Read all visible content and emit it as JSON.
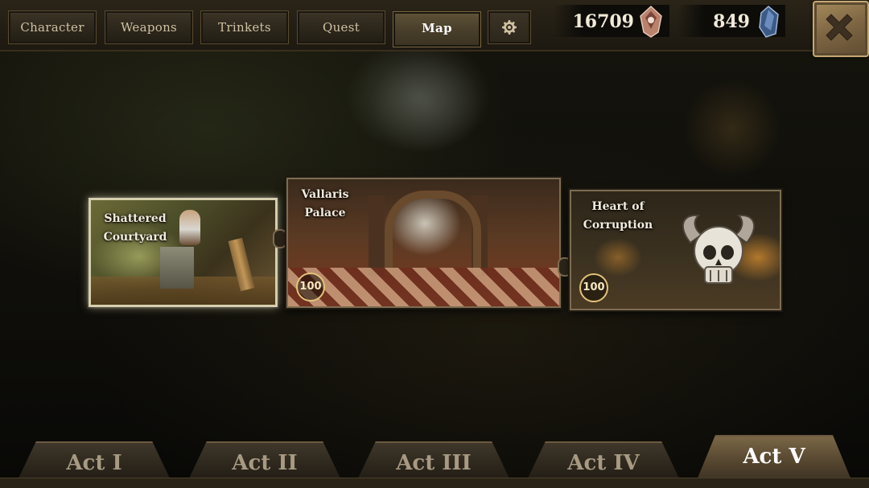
{
  "top_tabs": [
    {
      "label": "Character"
    },
    {
      "label": "Weapons"
    },
    {
      "label": "Trinkets"
    },
    {
      "label": "Quest"
    },
    {
      "label": "Map"
    }
  ],
  "active_top_tab": "Map",
  "icons": {
    "settings": "gear-icon",
    "gold": "gold-gem-icon",
    "gems": "blue-crystal-icon",
    "close": "close-x-icon"
  },
  "currency": {
    "gold": "16709",
    "gems": "849"
  },
  "levels": [
    {
      "name": "Shattered Courtyard",
      "line1": "Shattered",
      "line2": "Courtyard",
      "badge": ""
    },
    {
      "name": "Vallaris Palace",
      "line1": "Vallaris",
      "line2": "Palace",
      "badge": "100"
    },
    {
      "name": "Heart of Corruption",
      "line1": "Heart of",
      "line2": "Corruption",
      "badge": "100"
    }
  ],
  "acts": [
    {
      "label": "Act I"
    },
    {
      "label": "Act II"
    },
    {
      "label": "Act III"
    },
    {
      "label": "Act IV"
    },
    {
      "label": "Act V"
    }
  ],
  "active_act": "Act V",
  "colors": {
    "accent_gold": "#e3c27a",
    "active_tab": "#5e5237",
    "text_light": "#f3ecde"
  }
}
